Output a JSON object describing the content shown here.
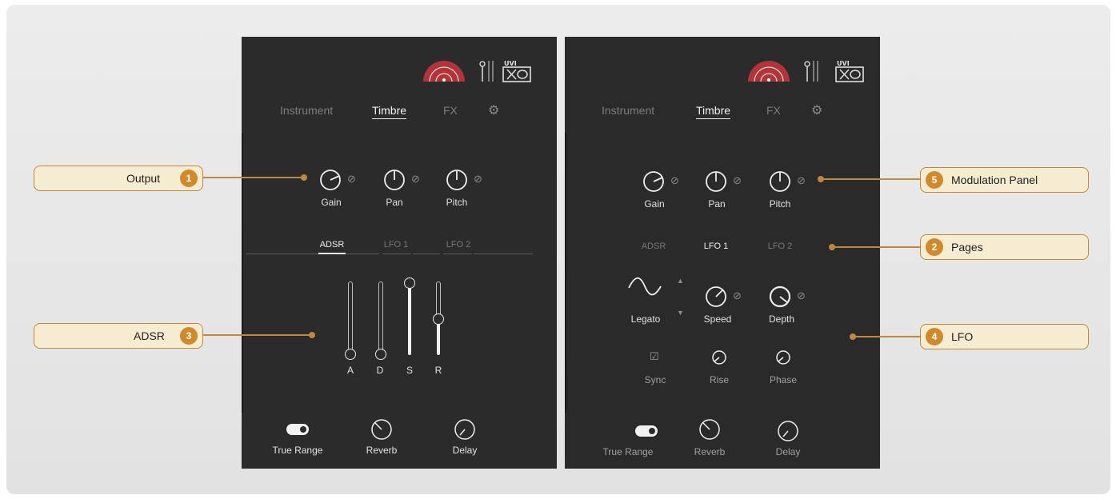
{
  "colors": {
    "panel_bg": "#2b2b2b",
    "accent": "#d08a2c",
    "callout_bg": "#f6ecd2",
    "callout_border": "#c0883c",
    "logo_red": "#b0343a"
  },
  "panels": [
    {
      "nav": {
        "instrument": "Instrument",
        "timbre": "Timbre",
        "fx": "FX",
        "settings_icon": "gear-icon",
        "active": "Timbre"
      },
      "output": {
        "gain": "Gain",
        "pan": "Pan",
        "pitch": "Pitch"
      },
      "tabs": {
        "adsr": "ADSR",
        "lfo1": "LFO 1",
        "lfo2": "LFO 2",
        "active": "ADSR"
      },
      "adsr": {
        "a": "A",
        "d": "D",
        "s": "S",
        "r": "R"
      },
      "footer": {
        "true_range": "True Range",
        "reverb": "Reverb",
        "delay": "Delay"
      }
    },
    {
      "nav": {
        "instrument": "Instrument",
        "timbre": "Timbre",
        "fx": "FX",
        "settings_icon": "gear-icon",
        "active": "Timbre"
      },
      "output": {
        "gain": "Gain",
        "pan": "Pan",
        "pitch": "Pitch"
      },
      "tabs": {
        "adsr": "ADSR",
        "lfo1": "LFO 1",
        "lfo2": "LFO 2",
        "active": "LFO 1"
      },
      "lfo": {
        "shape": "Legato",
        "speed": "Speed",
        "depth": "Depth",
        "sync": "Sync",
        "rise": "Rise",
        "phase": "Phase"
      },
      "footer": {
        "true_range": "True Range",
        "reverb": "Reverb",
        "delay": "Delay"
      }
    }
  ],
  "callouts": {
    "output": {
      "num": "1",
      "label": "Output"
    },
    "pages": {
      "num": "2",
      "label": "Pages"
    },
    "adsr": {
      "num": "3",
      "label": "ADSR"
    },
    "lfo": {
      "num": "4",
      "label": "LFO"
    },
    "modulation": {
      "num": "5",
      "label": "Modulation Panel"
    }
  }
}
